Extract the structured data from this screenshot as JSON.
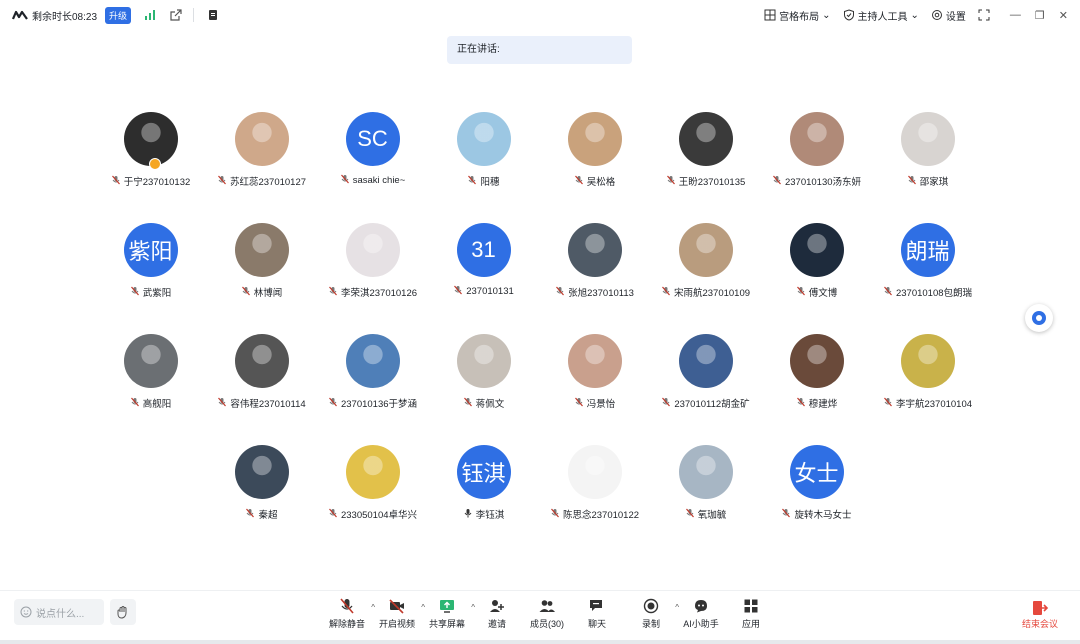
{
  "topbar": {
    "remaining": "剩余时长08:23",
    "upgrade": "升级",
    "layout": "宫格布局",
    "host_tools": "主持人工具",
    "settings": "设置"
  },
  "speaking": "正在讲话:",
  "participants": [
    {
      "name": "于宁237010132",
      "type": "photo",
      "color": "#2d2d2d",
      "host": true
    },
    {
      "name": "苏红蕊237010127",
      "type": "photo",
      "color": "#cfa88a"
    },
    {
      "name": "sasaki chie~",
      "type": "text",
      "avatar_text": "SC"
    },
    {
      "name": "阳穗",
      "type": "photo",
      "color": "#9cc7e3"
    },
    {
      "name": "吴松格",
      "type": "photo",
      "color": "#c9a27c"
    },
    {
      "name": "王盼237010135",
      "type": "photo",
      "color": "#3a3a3a"
    },
    {
      "name": "237010130汤东妍",
      "type": "photo",
      "color": "#b08a78"
    },
    {
      "name": "邵家琪",
      "type": "photo",
      "color": "#d8d4d1"
    },
    {
      "name": "武紫阳",
      "type": "text",
      "avatar_text": "紫阳"
    },
    {
      "name": "林博闻",
      "type": "photo",
      "color": "#8a7a6a"
    },
    {
      "name": "李荣淇237010126",
      "type": "photo",
      "color": "#e6e1e4"
    },
    {
      "name": "237010131",
      "type": "text",
      "avatar_text": "31"
    },
    {
      "name": "张旭237010113",
      "type": "photo",
      "color": "#4f5a66"
    },
    {
      "name": "宋雨航237010109",
      "type": "photo",
      "color": "#b99c7e"
    },
    {
      "name": "傅文博",
      "type": "photo",
      "color": "#1e2b3c"
    },
    {
      "name": "237010108包朗瑞",
      "type": "text",
      "avatar_text": "朗瑞"
    },
    {
      "name": "高舰阳",
      "type": "photo",
      "color": "#6b6f73"
    },
    {
      "name": "容伟程237010114",
      "type": "photo",
      "color": "#555555"
    },
    {
      "name": "237010136于梦涵",
      "type": "photo",
      "color": "#4f7fb8"
    },
    {
      "name": "蒋佩文",
      "type": "photo",
      "color": "#c7c0b8"
    },
    {
      "name": "冯景怡",
      "type": "photo",
      "color": "#c9a08d"
    },
    {
      "name": "237010112胡金矿",
      "type": "photo",
      "color": "#3e5f93"
    },
    {
      "name": "穆建烨",
      "type": "photo",
      "color": "#6a4a3a"
    },
    {
      "name": "李宇航237010104",
      "type": "photo",
      "color": "#c9b24a"
    },
    {
      "name": "秦超",
      "type": "photo",
      "color": "#3c4a5a"
    },
    {
      "name": "233050104卓华兴",
      "type": "photo",
      "color": "#e2c14a"
    },
    {
      "name": "李钰淇",
      "type": "text",
      "avatar_text": "钰淇",
      "mic_on": true
    },
    {
      "name": "陈思念237010122",
      "type": "photo",
      "color": "#f4f4f4"
    },
    {
      "name": "氧珈毓",
      "type": "photo",
      "color": "#a7b6c4"
    },
    {
      "name": "旋转木马女士",
      "type": "text",
      "avatar_text": "女士"
    }
  ],
  "bottom": {
    "chat_placeholder": "说点什么...",
    "tools": [
      {
        "label": "解除静音",
        "icon": "mic-muted-icon",
        "caret": true
      },
      {
        "label": "开启视频",
        "icon": "video-off-icon",
        "caret": true
      },
      {
        "label": "共享屏幕",
        "icon": "share-screen-icon",
        "caret": true
      },
      {
        "label": "邀请",
        "icon": "invite-icon",
        "caret": false
      },
      {
        "label": "成员(30)",
        "icon": "members-icon",
        "caret": false
      },
      {
        "label": "聊天",
        "icon": "chat-icon",
        "caret": false
      },
      {
        "label": "录制",
        "icon": "record-icon",
        "caret": true
      },
      {
        "label": "AI小助手",
        "icon": "ai-assistant-icon",
        "caret": false
      },
      {
        "label": "应用",
        "icon": "apps-icon",
        "caret": false
      }
    ],
    "end_meeting": "结束会议"
  },
  "colors": {
    "accent": "#2f6fe4",
    "end": "#e5483d",
    "muted_mic": "#c0392b"
  }
}
